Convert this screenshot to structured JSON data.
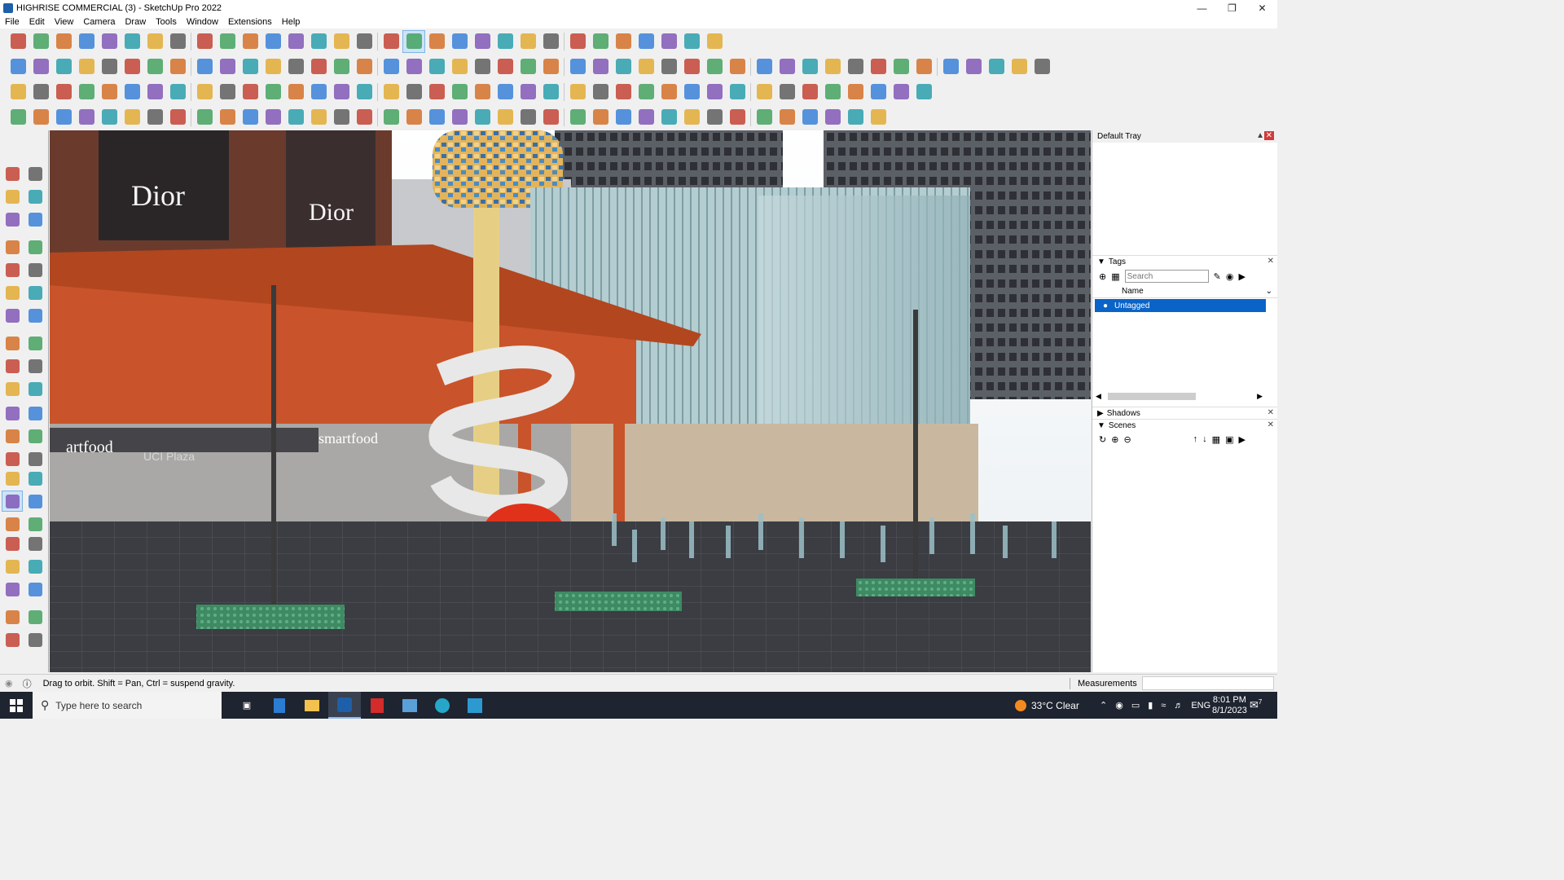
{
  "window": {
    "title": "HIGHRISE COMMERCIAL (3) - SketchUp Pro 2022"
  },
  "menu": [
    "File",
    "Edit",
    "View",
    "Camera",
    "Draw",
    "Tools",
    "Window",
    "Extensions",
    "Help"
  ],
  "viewport": {
    "signs": {
      "dior_left": "Dior",
      "dior_right": "Dior",
      "smartfood_left": "artfood",
      "smartfood_right": "smartfood",
      "plaza": "UCI Plaza"
    }
  },
  "tray": {
    "title": "Default Tray",
    "tags": {
      "header": "Tags",
      "search_placeholder": "Search",
      "column": "Name",
      "rows": [
        "Untagged"
      ]
    },
    "shadows": "Shadows",
    "scenes": "Scenes"
  },
  "status": {
    "hint": "Drag to orbit. Shift = Pan, Ctrl = suspend gravity.",
    "measurements_label": "Measurements",
    "measurements_value": ""
  },
  "taskbar": {
    "search_placeholder": "Type here to search",
    "weather": "33°C  Clear",
    "lang": "ENG",
    "time": "8:01 PM",
    "date": "8/1/2023",
    "notif_count": "7"
  },
  "colors": {
    "accent": "#0a64c8",
    "selection": "#1a73d1"
  }
}
